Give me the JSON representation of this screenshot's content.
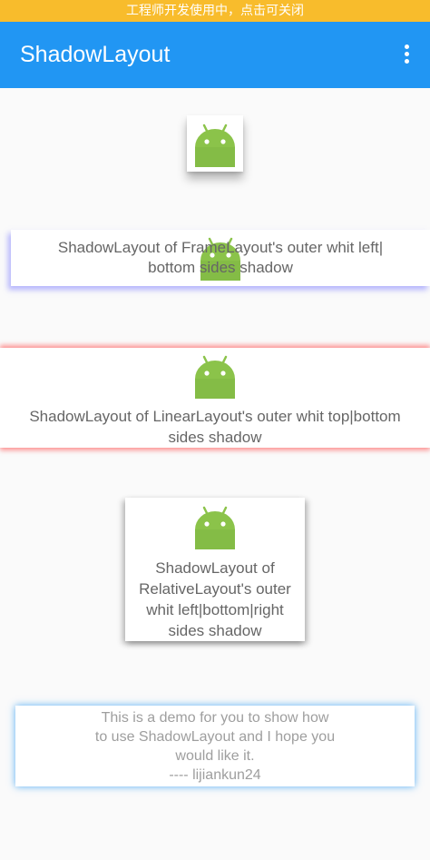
{
  "banner": {
    "text": "工程师开发使用中，点击可关闭"
  },
  "appbar": {
    "title": "ShadowLayout",
    "menu_icon": "more-vert-icon"
  },
  "colors": {
    "appbar": "#2196f3",
    "banner": "#f8bc2c",
    "android_green": "#8bc34a"
  },
  "cards": [
    {
      "icon": "android-icon",
      "text": ""
    },
    {
      "icon": "android-icon",
      "text": "ShadowLayout of FrameLayout's outer whit left|\nbottom sides shadow"
    },
    {
      "icon": "android-icon",
      "text": "ShadowLayout of LinearLayout's outer whit top|bottom\nsides shadow"
    },
    {
      "icon": "android-icon",
      "text": "ShadowLayout of\nRelativeLayout's outer\nwhit left|bottom|right\nsides shadow"
    },
    {
      "text": "This is a demo for you to show how\nto use ShadowLayout and I hope you\nwould like it.\n---- lijiankun24"
    }
  ]
}
